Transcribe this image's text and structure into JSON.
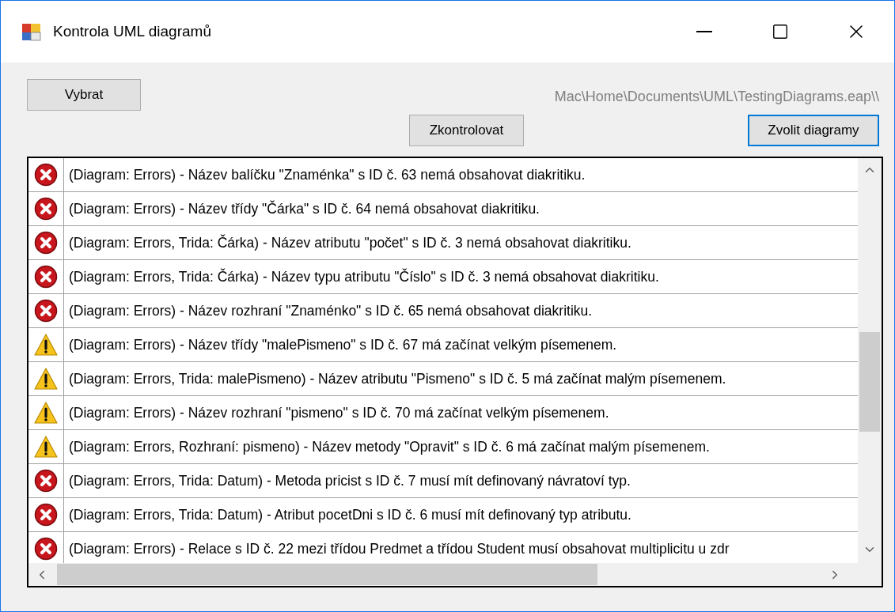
{
  "window": {
    "title": "Kontrola UML diagramů"
  },
  "buttons": {
    "select": "Vybrat",
    "check": "Zkontrolovat",
    "choose": "Zvolit diagramy"
  },
  "path": "Mac\\Home\\Documents\\UML\\TestingDiagrams.eap\\\\",
  "messages": [
    {
      "kind": "error",
      "text": "(Diagram: Errors) - Název balíčku \"Znaménka\" s ID č. 63 nemá obsahovat diakritiku."
    },
    {
      "kind": "error",
      "text": "(Diagram: Errors) - Název třídy \"Čárka\" s ID č. 64 nemá obsahovat diakritiku."
    },
    {
      "kind": "error",
      "text": "(Diagram: Errors, Trida: Čárka) - Název atributu \"počet\" s ID č. 3 nemá obsahovat diakritiku."
    },
    {
      "kind": "error",
      "text": "(Diagram: Errors, Trida: Čárka) - Název typu atributu \"Číslo\" s ID č. 3 nemá obsahovat diakritiku."
    },
    {
      "kind": "error",
      "text": "(Diagram: Errors) - Název rozhraní \"Znaménko\" s ID č. 65 nemá obsahovat diakritiku."
    },
    {
      "kind": "warning",
      "text": "(Diagram: Errors) - Název třídy \"malePismeno\" s ID č. 67 má začínat velkým písemenem."
    },
    {
      "kind": "warning",
      "text": "(Diagram: Errors, Trida: malePismeno) - Název atributu \"Pismeno\" s ID č. 5 má začínat malým písemenem."
    },
    {
      "kind": "warning",
      "text": "(Diagram: Errors) - Název rozhraní \"pismeno\" s ID č. 70 má začínat velkým písemenem."
    },
    {
      "kind": "warning",
      "text": "(Diagram: Errors, Rozhraní: pismeno) - Název metody \"Opravit\" s ID č. 6 má začínat malým písemenem."
    },
    {
      "kind": "error",
      "text": "(Diagram: Errors, Trida: Datum) - Metoda pricist s ID č. 7 musí mít definovaný návratoví typ."
    },
    {
      "kind": "error",
      "text": "(Diagram: Errors, Trida: Datum) - Atribut pocetDni s ID č. 6 musí mít definovaný typ atributu."
    },
    {
      "kind": "error",
      "text": "(Diagram: Errors) - Relace s ID č. 22 mezi třídou Predmet a třídou Student musí obsahovat multiplicitu u zdr"
    }
  ]
}
